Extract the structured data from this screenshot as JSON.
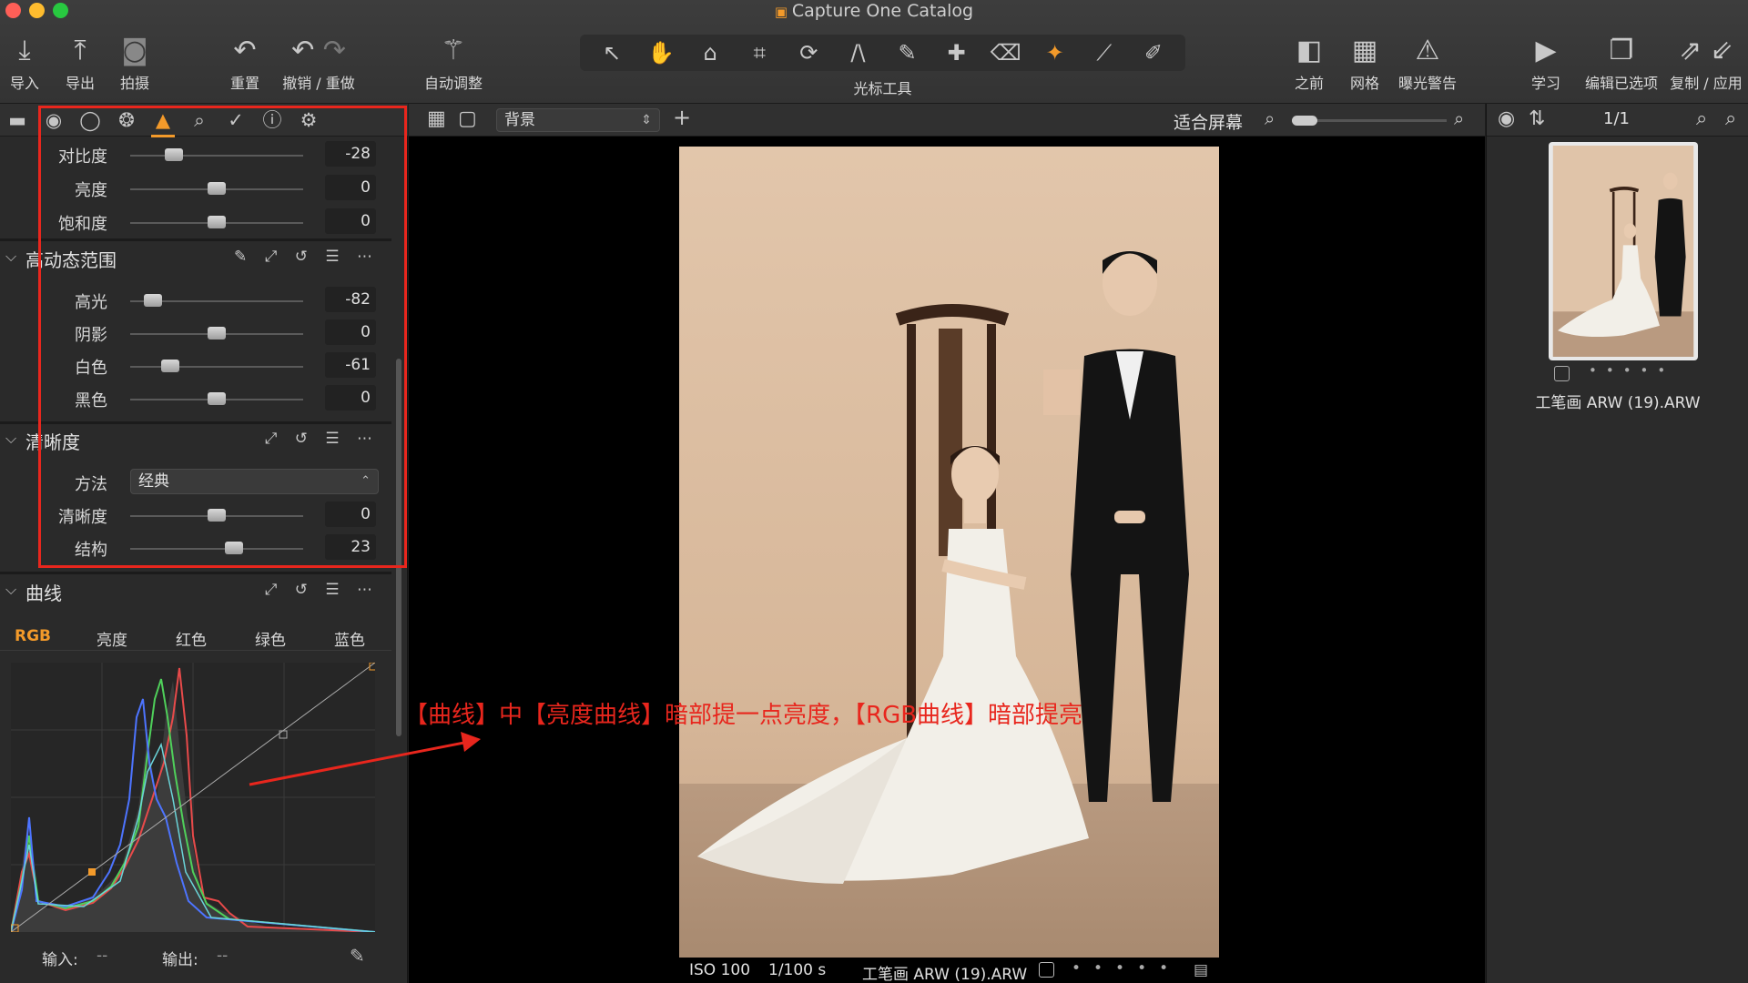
{
  "window": {
    "title": "Capture One Catalog",
    "traffic_colors": [
      "#fe5f57",
      "#febc2e",
      "#28c840"
    ]
  },
  "toolbar": {
    "left": [
      {
        "name": "import",
        "icon": "download-tray-icon",
        "label": "导入"
      },
      {
        "name": "export",
        "icon": "upload-tray-icon",
        "label": "导出"
      },
      {
        "name": "capture",
        "icon": "camera-icon",
        "label": "拍摄"
      }
    ],
    "history": [
      {
        "name": "reset",
        "icon": "reset-arrow-icon",
        "label": "重置"
      },
      {
        "name": "undo-redo",
        "icon": "undo-redo-icon",
        "label": "撤销 / 重做"
      }
    ],
    "auto_adjust": {
      "icon": "magic-wand-icon",
      "label": "自动调整"
    },
    "cursor_tools_label": "光标工具",
    "cursor_tools": [
      {
        "name": "select-tool",
        "glyph": "↖",
        "active": false
      },
      {
        "name": "pan-tool",
        "glyph": "✋",
        "active": false
      },
      {
        "name": "loupe-tool",
        "glyph": "⌂",
        "active": false
      },
      {
        "name": "crop-tool",
        "glyph": "⌗",
        "active": false
      },
      {
        "name": "rotate-tool",
        "glyph": "⟳",
        "active": false
      },
      {
        "name": "keystone-tool",
        "glyph": "/\\",
        "active": false
      },
      {
        "name": "spot-tool",
        "glyph": "✎",
        "active": false
      },
      {
        "name": "heal-tool",
        "glyph": "✚",
        "active": false
      },
      {
        "name": "eraser-tool",
        "glyph": "⌫",
        "active": false
      },
      {
        "name": "brush-tool",
        "glyph": "✦",
        "active": true
      },
      {
        "name": "gradient-tool",
        "glyph": "⟋",
        "active": false
      },
      {
        "name": "picker-tool",
        "glyph": "✐",
        "active": false
      }
    ],
    "right": [
      {
        "name": "before",
        "icon": "before-after-icon",
        "label": "之前"
      },
      {
        "name": "grid",
        "icon": "grid-icon",
        "label": "网格"
      },
      {
        "name": "exposure-warning",
        "icon": "warning-triangle-icon",
        "label": "曝光警告"
      },
      {
        "name": "learn",
        "icon": "play-icon",
        "label": "学习"
      },
      {
        "name": "edit-selected",
        "icon": "layers-icon",
        "label": "编辑已选项"
      },
      {
        "name": "copy-apply",
        "icon": "copy-apply-icon",
        "label": "复制 / 应用"
      }
    ]
  },
  "tool_tabs": [
    {
      "name": "library",
      "glyph": "▬",
      "active": false
    },
    {
      "name": "capture",
      "glyph": "◉",
      "active": false
    },
    {
      "name": "lens",
      "glyph": "◯",
      "active": false
    },
    {
      "name": "color",
      "glyph": "❂",
      "active": false
    },
    {
      "name": "exposure",
      "glyph": "▲",
      "active": true
    },
    {
      "name": "details",
      "glyph": "⌕",
      "active": false
    },
    {
      "name": "adjustments",
      "glyph": "✓",
      "active": false
    },
    {
      "name": "metadata",
      "glyph": "ⓘ",
      "active": false
    },
    {
      "name": "settings",
      "glyph": "⚙",
      "active": false
    }
  ],
  "panel_top": {
    "rows": [
      {
        "name": "contrast",
        "label": "对比度",
        "value": "-28",
        "pos": 0.25
      },
      {
        "name": "brightness",
        "label": "亮度",
        "value": "0",
        "pos": 0.5
      },
      {
        "name": "saturation",
        "label": "饱和度",
        "value": "0",
        "pos": 0.5
      }
    ]
  },
  "hdr": {
    "title": "高动态范围",
    "actions": "✎ ⤢ ↺ ☰ ⋯",
    "rows": [
      {
        "name": "highlights",
        "label": "高光",
        "value": "-82",
        "pos": 0.13
      },
      {
        "name": "shadows",
        "label": "阴影",
        "value": "0",
        "pos": 0.5
      },
      {
        "name": "whites",
        "label": "白色",
        "value": "-61",
        "pos": 0.23
      },
      {
        "name": "blacks",
        "label": "黑色",
        "value": "0",
        "pos": 0.5
      }
    ]
  },
  "clarity": {
    "title": "清晰度",
    "actions": "⤢ ↺ ☰ ⋯",
    "method_label": "方法",
    "method_value": "经典",
    "rows": [
      {
        "name": "clarity",
        "label": "清晰度",
        "value": "0",
        "pos": 0.5
      },
      {
        "name": "structure",
        "label": "结构",
        "value": "23",
        "pos": 0.6
      }
    ]
  },
  "curve": {
    "title": "曲线",
    "actions": "⤢ ↺ ☰ ⋯",
    "tabs": [
      {
        "name": "rgb",
        "label": "RGB",
        "active": true
      },
      {
        "name": "luma",
        "label": "亮度",
        "active": false
      },
      {
        "name": "red",
        "label": "红色",
        "active": false
      },
      {
        "name": "green",
        "label": "绿色",
        "active": false
      },
      {
        "name": "blue",
        "label": "蓝色",
        "active": false
      }
    ],
    "input_label": "输入:",
    "input_value": "--",
    "output_label": "输出:",
    "output_value": "--"
  },
  "viewer": {
    "layer_select": "背景",
    "fit_label": "适合屏幕",
    "iso": "ISO 100",
    "shutter": "1/100 s",
    "filename": "工笔画 ARW (19).ARW",
    "annotation": "【曲线】中【亮度曲线】暗部提一点亮度，【RGB曲线】暗部提亮"
  },
  "browser": {
    "count": "1/1",
    "thumb_name": "工笔画 ARW (19).ARW"
  },
  "colors": {
    "accent": "#f39a2a",
    "highlight": "#e8261d",
    "backdrop": "#d9b99c"
  }
}
